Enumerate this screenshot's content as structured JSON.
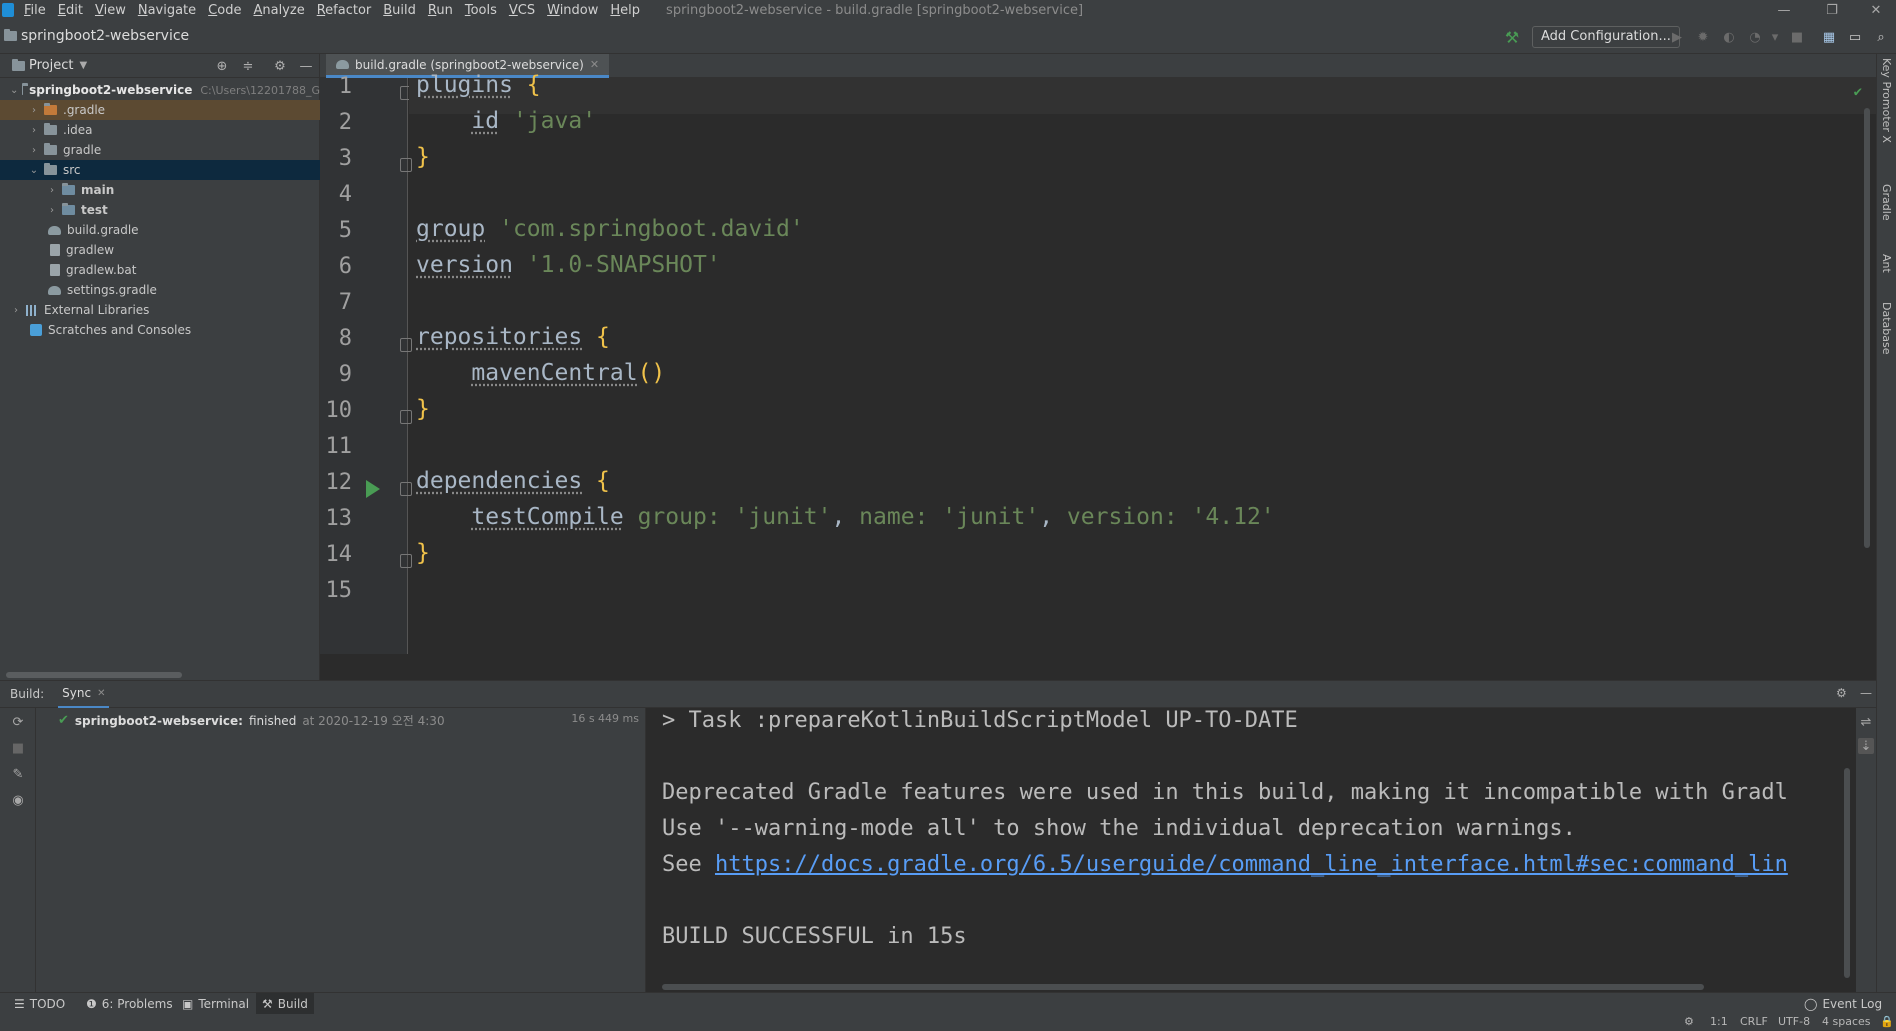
{
  "window": {
    "title": "springboot2-webservice - build.gradle [springboot2-webservice]"
  },
  "menu": [
    "File",
    "Edit",
    "View",
    "Navigate",
    "Code",
    "Analyze",
    "Refactor",
    "Build",
    "Run",
    "Tools",
    "VCS",
    "Window",
    "Help"
  ],
  "navbar": {
    "project_name": "springboot2-webservice",
    "add_configuration": "Add Configuration..."
  },
  "project_panel": {
    "header": "Project",
    "root": "springboot2-webservice",
    "root_path": "C:\\Users\\12201788_G",
    "items": [
      {
        "label": ".gradle"
      },
      {
        "label": ".idea"
      },
      {
        "label": "gradle"
      },
      {
        "label": "src"
      },
      {
        "label": "main"
      },
      {
        "label": "test"
      },
      {
        "label": "build.gradle"
      },
      {
        "label": "gradlew"
      },
      {
        "label": "gradlew.bat"
      },
      {
        "label": "settings.gradle"
      },
      {
        "label": "External Libraries"
      },
      {
        "label": "Scratches and Consoles"
      }
    ]
  },
  "editor": {
    "tab_label": "build.gradle (springboot2-webservice)",
    "line_numbers": [
      "1",
      "2",
      "3",
      "4",
      "5",
      "6",
      "7",
      "8",
      "9",
      "10",
      "11",
      "12",
      "13",
      "14",
      "15"
    ],
    "code": {
      "l1_kw": "plugins",
      "l1_brace": "{",
      "l2_kw": "id",
      "l2_str": "'java'",
      "l3_brace": "}",
      "l5_kw": "group",
      "l5_str": "'com.springboot.david'",
      "l6_kw": "version",
      "l6_str": "'1.0-SNAPSHOT'",
      "l8_kw": "repositories",
      "l8_brace": "{",
      "l9_kw": "mavenCentral",
      "l9_paren": "()",
      "l10_brace": "}",
      "l12_kw": "dependencies",
      "l12_brace": "{",
      "l13_kw": "testCompile",
      "l13_group": "group:",
      "l13_group_val": "'junit'",
      "l13_name": "name:",
      "l13_name_val": "'junit'",
      "l13_version": "version:",
      "l13_version_val": "'4.12'",
      "l14_brace": "}"
    }
  },
  "right_strip": [
    "Key Promoter X",
    "Gradle",
    "Ant",
    "Database"
  ],
  "build": {
    "label": "Build:",
    "tab": "Sync",
    "tree_name": "springboot2-webservice:",
    "tree_status": "finished",
    "tree_time": "at 2020-12-19 오전 4:30",
    "duration": "16 s 449 ms",
    "console": {
      "line1": "> Task :prepareKotlinBuildScriptModel UP-TO-DATE",
      "line3": "Deprecated Gradle features were used in this build, making it incompatible with Gradl",
      "line4": "Use '--warning-mode all' to show the individual deprecation warnings.",
      "line5_prefix": "See ",
      "line5_link": "https://docs.gradle.org/6.5/userguide/command_line_interface.html#sec:command_lin",
      "line7": "BUILD SUCCESSFUL in 15s"
    }
  },
  "bottom_tools": {
    "todo": "TODO",
    "problems": "6: Problems",
    "terminal": "Terminal",
    "build": "Build",
    "event_log": "Event Log"
  },
  "status": {
    "position": "1:1",
    "line_sep": "CRLF",
    "encoding": "UTF-8",
    "indent": "4 spaces"
  },
  "colors": {
    "accent": "#4a88c7",
    "success": "#499c54",
    "string": "#6a8759",
    "brace": "#f0c24a"
  }
}
